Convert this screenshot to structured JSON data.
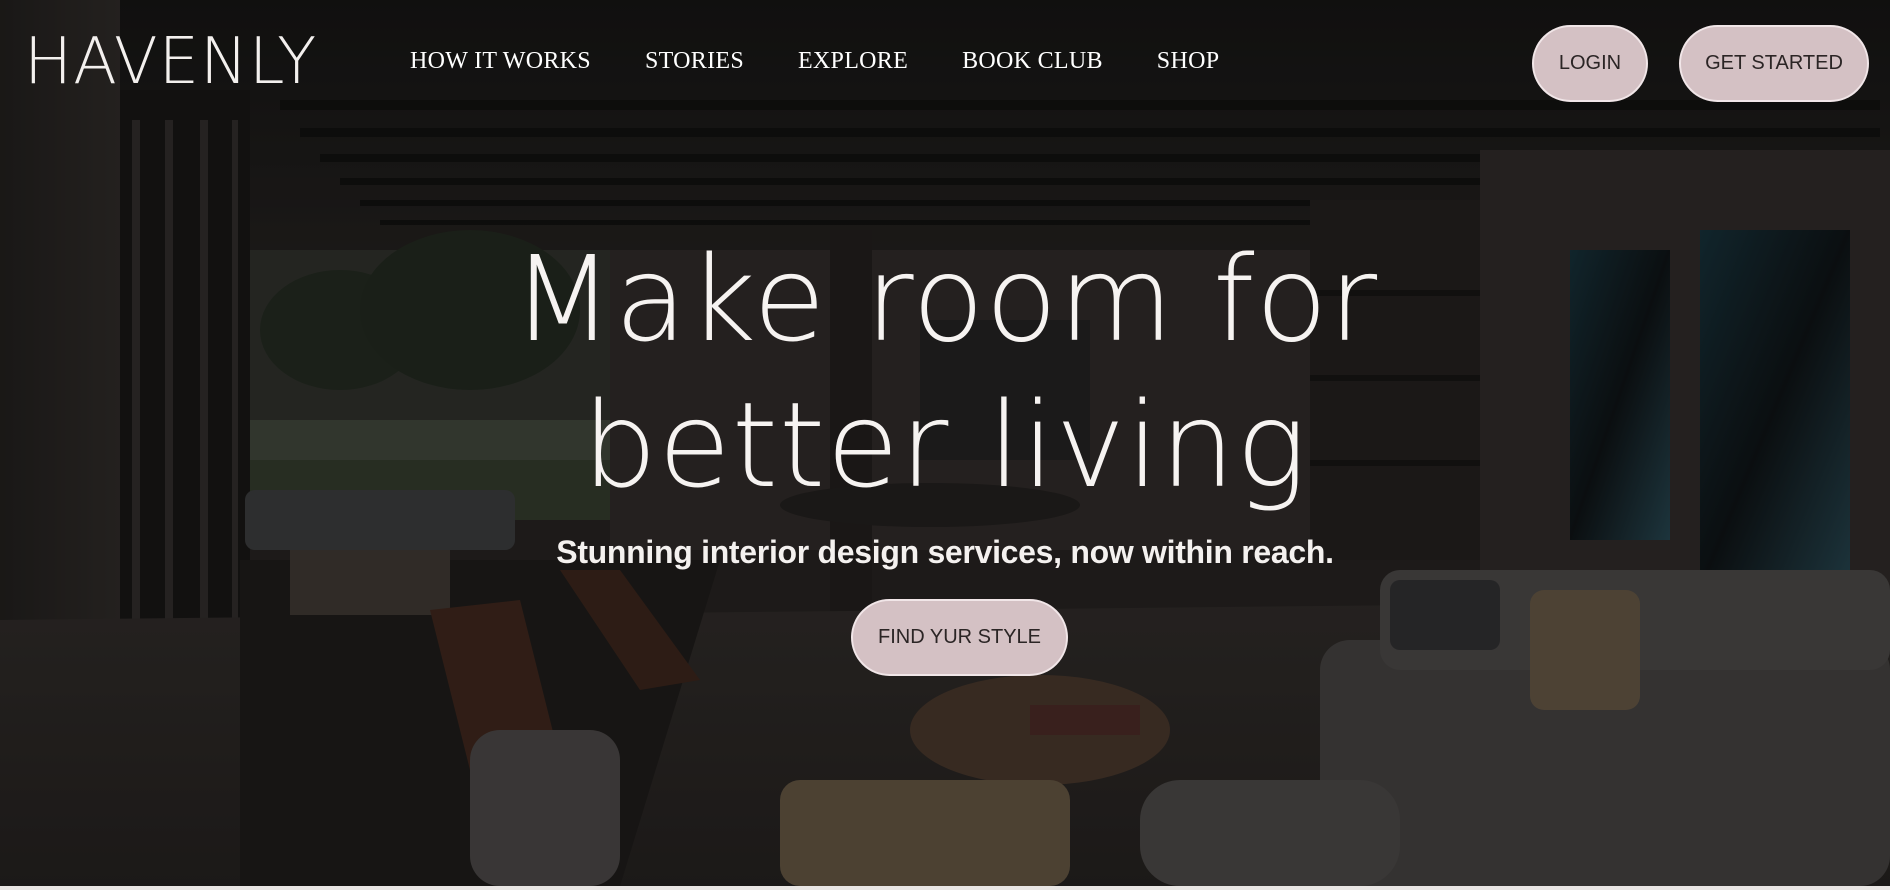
{
  "brand": {
    "logo_text": "HAVENLY"
  },
  "nav": {
    "items": [
      {
        "label": "HOW IT WORKS"
      },
      {
        "label": "STORIES"
      },
      {
        "label": "EXPLORE"
      },
      {
        "label": "BOOK CLUB"
      },
      {
        "label": "SHOP"
      }
    ]
  },
  "header_actions": {
    "login_label": "LOGIN",
    "get_started_label": "GET STARTED"
  },
  "hero": {
    "headline_line1": "Make room for",
    "headline_line2": "better living",
    "subheadline": "Stunning interior design services, now within reach.",
    "cta_label": "FIND YUR STYLE",
    "background_image": "modern-living-room-photo"
  },
  "colors": {
    "button_bg": "#d4c1c4",
    "button_text": "#2b2525",
    "overlay": "#000000",
    "text_light": "#ffffff"
  }
}
